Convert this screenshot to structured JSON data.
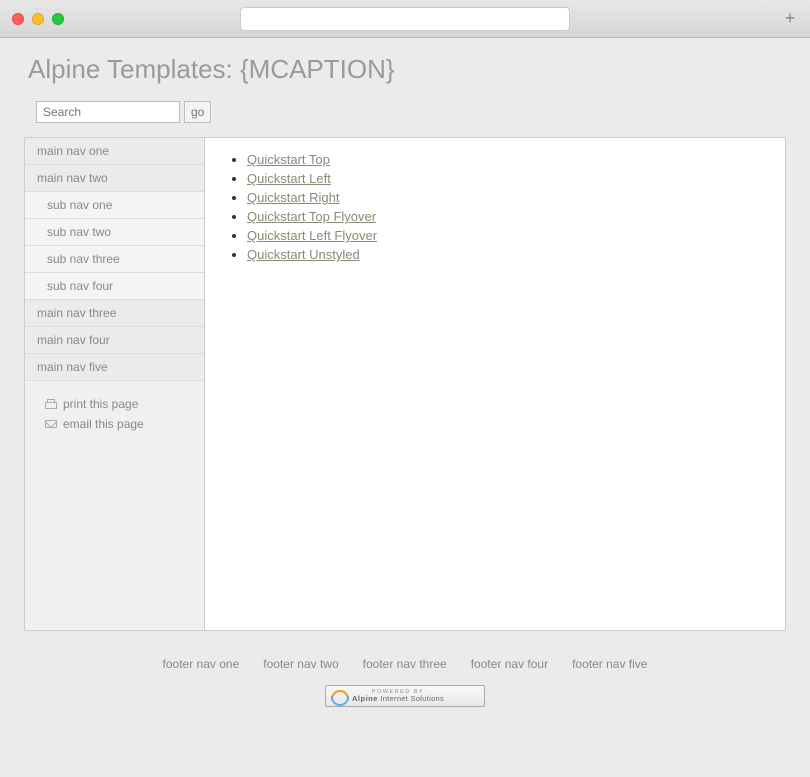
{
  "header": {
    "title": "Alpine Templates: {MCAPTION}"
  },
  "search": {
    "placeholder": "Search",
    "button_label": "go"
  },
  "sidebar": {
    "nav": [
      {
        "label": "main nav one",
        "sub": false
      },
      {
        "label": "main nav two",
        "sub": false
      },
      {
        "label": "sub nav one",
        "sub": true
      },
      {
        "label": "sub nav two",
        "sub": true
      },
      {
        "label": "sub nav three",
        "sub": true
      },
      {
        "label": "sub nav four",
        "sub": true
      },
      {
        "label": "main nav three",
        "sub": false
      },
      {
        "label": "main nav four",
        "sub": false
      },
      {
        "label": "main nav five",
        "sub": false
      }
    ],
    "tools": {
      "print_label": "print this page",
      "email_label": "email this page"
    }
  },
  "content": {
    "links": [
      "Quickstart Top",
      "Quickstart Left",
      "Quickstart Right",
      "Quickstart Top Flyover",
      "Quickstart Left Flyover",
      "Quickstart Unstyled"
    ]
  },
  "footer": {
    "nav": [
      "footer nav one",
      "footer nav two",
      "footer nav three",
      "footer nav four",
      "footer nav five"
    ],
    "powered": {
      "small": "Powered by",
      "brand_bold": "Alpine",
      "brand_rest": " Internet Solutions"
    }
  }
}
